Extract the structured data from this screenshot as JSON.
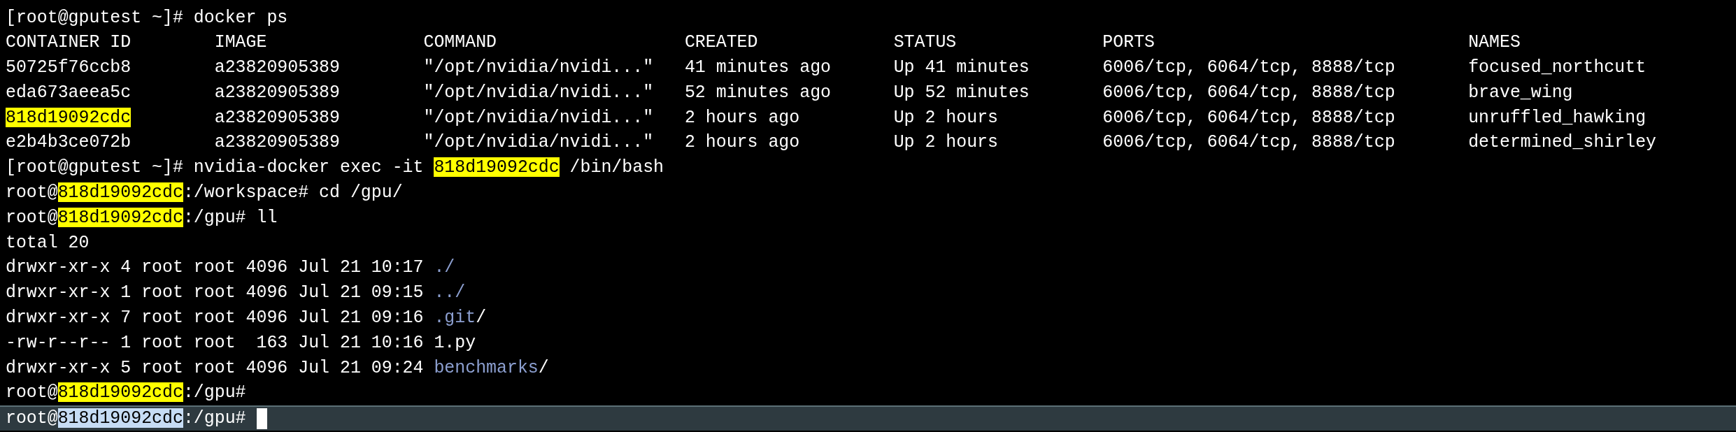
{
  "terminal": {
    "lines": [
      {
        "segments": [
          {
            "kind": "text",
            "text": "[root@gputest ~]# docker ps"
          }
        ]
      },
      {
        "segments": [
          {
            "kind": "text",
            "text": "CONTAINER ID        IMAGE               COMMAND                  CREATED             STATUS              PORTS                              NAMES"
          }
        ]
      },
      {
        "segments": [
          {
            "kind": "text",
            "text": "50725f76ccb8        a23820905389        \"/opt/nvidia/nvidi...\"   41 minutes ago      Up 41 minutes       6006/tcp, 6064/tcp, 8888/tcp       focused_northcutt"
          }
        ]
      },
      {
        "segments": [
          {
            "kind": "text",
            "text": "eda673aeea5c        a23820905389        \"/opt/nvidia/nvidi...\"   52 minutes ago      Up 52 minutes       6006/tcp, 6064/tcp, 8888/tcp       brave_wing"
          }
        ]
      },
      {
        "segments": [
          {
            "kind": "highlight",
            "text": "818d19092cdc"
          },
          {
            "kind": "text",
            "text": "        a23820905389        \"/opt/nvidia/nvidi...\"   2 hours ago         Up 2 hours          6006/tcp, 6064/tcp, 8888/tcp       unruffled_hawking"
          }
        ]
      },
      {
        "segments": [
          {
            "kind": "text",
            "text": "e2b4b3ce072b        a23820905389        \"/opt/nvidia/nvidi...\"   2 hours ago         Up 2 hours          6006/tcp, 6064/tcp, 8888/tcp       determined_shirley"
          }
        ]
      },
      {
        "segments": [
          {
            "kind": "text",
            "text": "[root@gputest ~]# nvidia-docker exec -it "
          },
          {
            "kind": "highlight",
            "text": "818d19092cdc"
          },
          {
            "kind": "text",
            "text": " /bin/bash"
          }
        ]
      },
      {
        "segments": [
          {
            "kind": "text",
            "text": "root@"
          },
          {
            "kind": "highlight",
            "text": "818d19092cdc"
          },
          {
            "kind": "text",
            "text": ":/workspace# cd /gpu/"
          }
        ]
      },
      {
        "segments": [
          {
            "kind": "text",
            "text": "root@"
          },
          {
            "kind": "highlight",
            "text": "818d19092cdc"
          },
          {
            "kind": "text",
            "text": ":/gpu# ll"
          }
        ]
      },
      {
        "segments": [
          {
            "kind": "text",
            "text": "total 20"
          }
        ]
      },
      {
        "segments": [
          {
            "kind": "text",
            "text": "drwxr-xr-x 4 root root 4096 Jul 21 10:17 "
          },
          {
            "kind": "dir",
            "text": "./"
          }
        ]
      },
      {
        "segments": [
          {
            "kind": "text",
            "text": "drwxr-xr-x 1 root root 4096 Jul 21 09:15 "
          },
          {
            "kind": "dir",
            "text": "../"
          }
        ]
      },
      {
        "segments": [
          {
            "kind": "text",
            "text": "drwxr-xr-x 7 root root 4096 Jul 21 09:16 "
          },
          {
            "kind": "dir",
            "text": ".git"
          },
          {
            "kind": "text",
            "text": "/"
          }
        ]
      },
      {
        "segments": [
          {
            "kind": "text",
            "text": "-rw-r--r-- 1 root root  163 Jul 21 10:16 1.py"
          }
        ]
      },
      {
        "segments": [
          {
            "kind": "text",
            "text": "drwxr-xr-x 5 root root 4096 Jul 21 09:24 "
          },
          {
            "kind": "dir",
            "text": "benchmarks"
          },
          {
            "kind": "text",
            "text": "/"
          }
        ]
      },
      {
        "segments": [
          {
            "kind": "text",
            "text": "root@"
          },
          {
            "kind": "highlight",
            "text": "818d19092cdc"
          },
          {
            "kind": "text",
            "text": ":/gpu#"
          }
        ]
      },
      {
        "current": true,
        "cursor": true,
        "segments": [
          {
            "kind": "text",
            "text": "root@"
          },
          {
            "kind": "selected",
            "text": "818d19092cdc"
          },
          {
            "kind": "text",
            "text": ":/gpu# "
          }
        ]
      }
    ]
  }
}
